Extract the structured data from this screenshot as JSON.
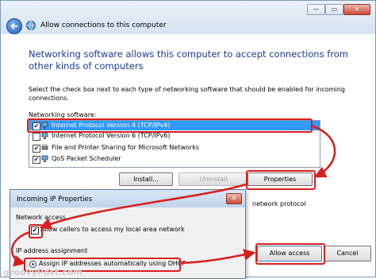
{
  "window": {
    "title": "Allow connections to this computer",
    "controls": {
      "minimize": "—",
      "maximize": "▭",
      "close": "✕"
    }
  },
  "main": {
    "heading": "Networking software allows this computer to accept connections from other kinds of computers",
    "instruction": "Select the check box next to each type of networking software that should be enabled for incoming connections.",
    "networking_software_label": "Networking software:",
    "software_items": [
      {
        "label": "Internet Protocol Version 4 (TCP/IPv4)",
        "checked": true,
        "selected": true
      },
      {
        "label": "Internet Protocol Version 6 (TCP/IPv6)",
        "checked": false,
        "selected": false
      },
      {
        "label": "File and Printer Sharing for Microsoft Networks",
        "checked": true,
        "selected": false
      },
      {
        "label": "QoS Packet Scheduler",
        "checked": true,
        "selected": false
      }
    ],
    "buttons": {
      "install": "Install...",
      "uninstall": "Uninstall",
      "properties": "Properties",
      "allow_access": "Allow access",
      "cancel": "Cancel"
    },
    "incoming_partial": "Incoming IP Properties",
    "description_partial": "network protocol"
  },
  "dialog": {
    "title": "Incoming IP Properties",
    "network_access_label": "Network access",
    "allow_callers_label": "Allow callers to access my local area network",
    "allow_callers_checked": true,
    "ip_assignment_label": "IP address assignment",
    "dhcp_option_label": "Assign IP addresses automatically using DHCP",
    "dhcp_selected": true
  },
  "watermark": "groovyPost.com",
  "colors": {
    "highlight": "#d81f1f",
    "heading": "#1a3a8f",
    "selection": "#3399ff"
  },
  "icons": {
    "back": "back-arrow-icon",
    "network": "network-icon",
    "protocol": "network-component-icon"
  }
}
